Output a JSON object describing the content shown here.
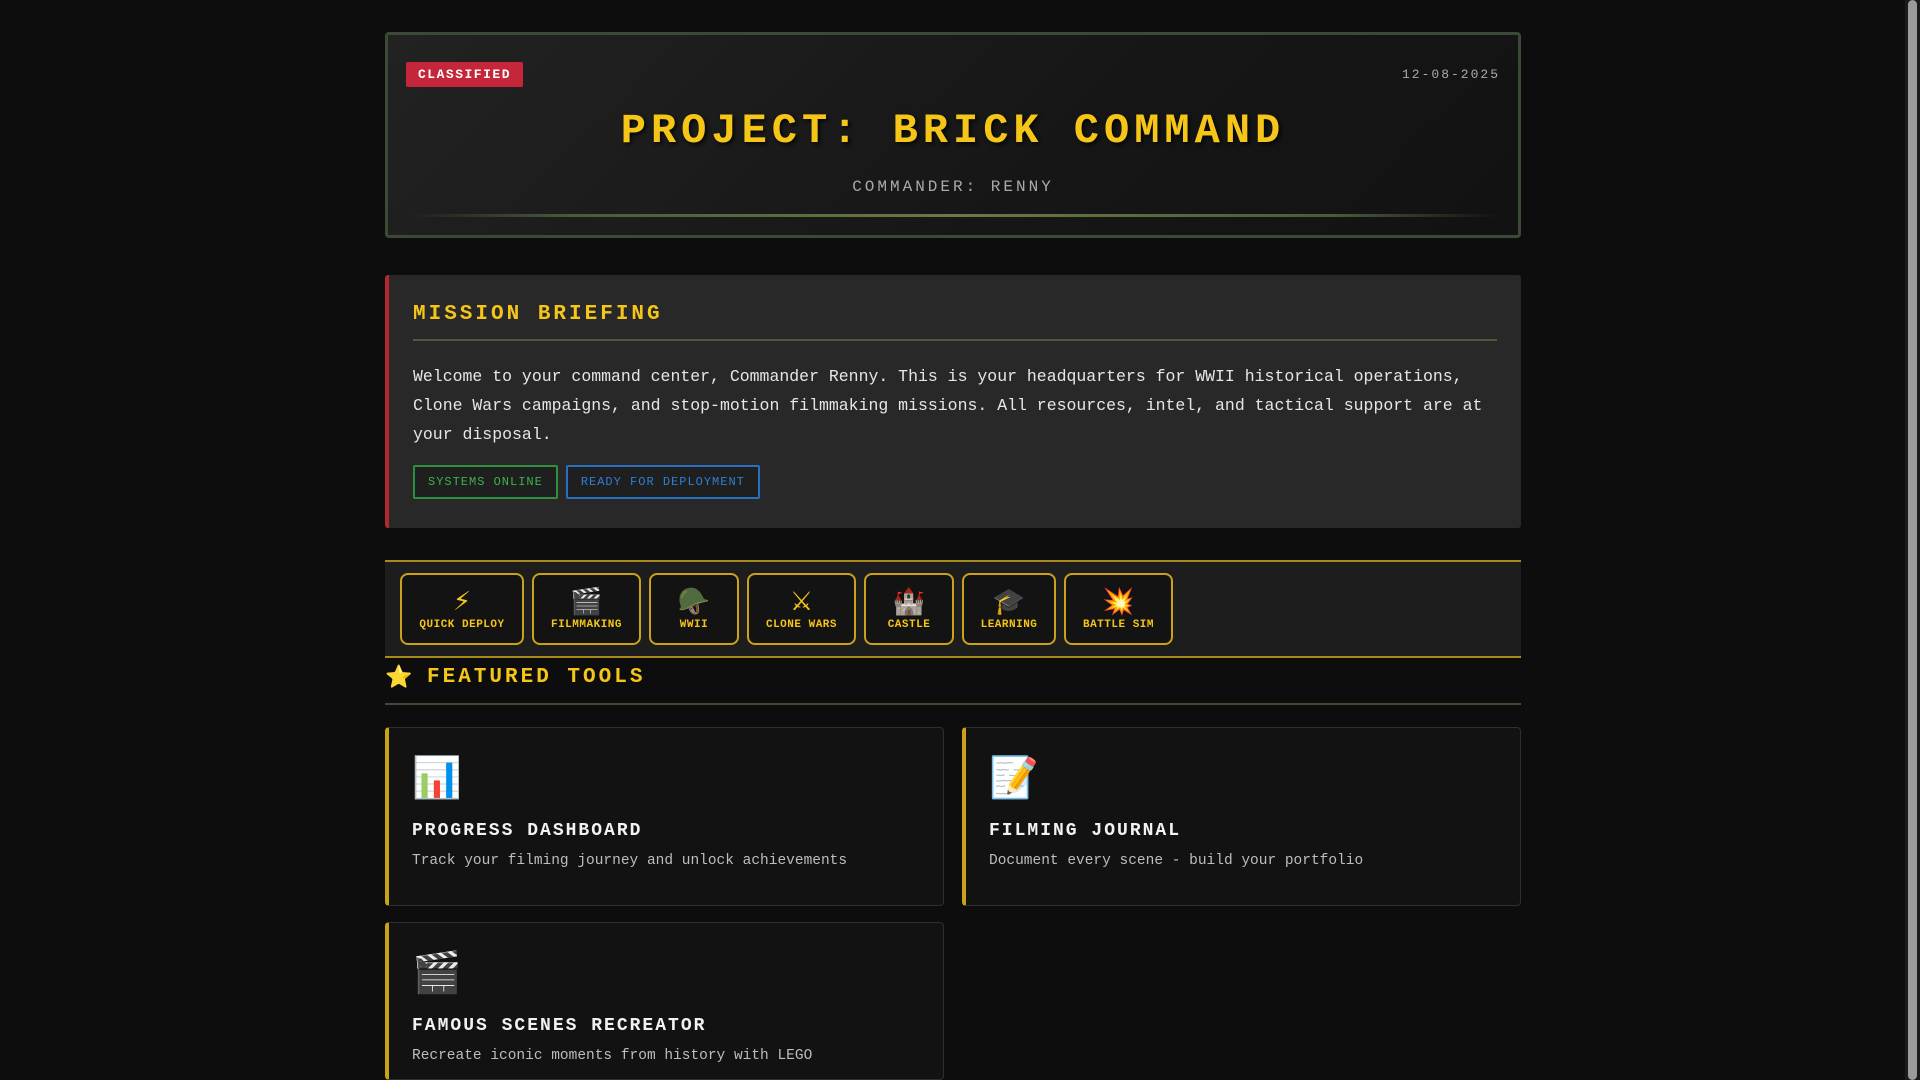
{
  "header": {
    "classified_badge": "CLASSIFIED",
    "date": "12-08-2025",
    "title": "PROJECT: BRICK COMMAND",
    "commander": "COMMANDER: RENNY"
  },
  "briefing": {
    "title": "MISSION BRIEFING",
    "text": "Welcome to your command center, Commander Renny. This is your headquarters for WWII historical operations, Clone Wars campaigns, and stop-motion filmmaking missions. All resources, intel, and tactical support are at your disposal.",
    "status_online": "SYSTEMS ONLINE",
    "status_ready": "READY FOR DEPLOYMENT"
  },
  "nav": {
    "items": [
      {
        "icon": "⚡",
        "label": "QUICK DEPLOY"
      },
      {
        "icon": "🎬",
        "label": "FILMMAKING"
      },
      {
        "icon": "🪖",
        "label": "WWII"
      },
      {
        "icon": "⚔",
        "label": "CLONE WARS"
      },
      {
        "icon": "🏰",
        "label": "CASTLE"
      },
      {
        "icon": "🎓",
        "label": "LEARNING"
      },
      {
        "icon": "💥",
        "label": "BATTLE SIM"
      }
    ]
  },
  "featured": {
    "star_icon": "⭐",
    "title": "FEATURED TOOLS",
    "cards": [
      {
        "icon": "📊",
        "title": "PROGRESS DASHBOARD",
        "desc": "Track your filming journey and unlock achievements"
      },
      {
        "icon": "📝",
        "title": "FILMING JOURNAL",
        "desc": "Document every scene - build your portfolio"
      },
      {
        "icon": "🎬",
        "title": "FAMOUS SCENES RECREATOR",
        "desc": "Recreate iconic moments from history with LEGO"
      }
    ]
  },
  "colors": {
    "accent_gold": "#f5c518",
    "classified_red": "#c62639",
    "status_green": "#3bb34a",
    "status_blue": "#2f7fd4"
  }
}
